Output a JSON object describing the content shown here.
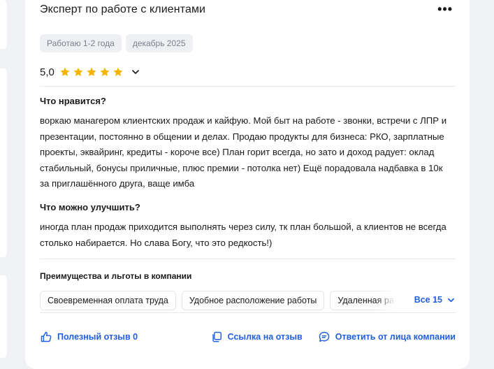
{
  "review": {
    "job_title": "Эксперт по работе с клиентами",
    "tags": [
      "Работаю 1-2 года",
      "декабрь 2025"
    ],
    "rating": "5,0",
    "stars_filled": 5,
    "likes_title": "Что нравится?",
    "likes_text": "воркаю манагером клиентских продаж и кайфую. Мой быт на работе - звонки, встречи с ЛПР и презентации, постоянно в общении и делах. Продаю продукты для бизнеса: РКО, зарплатные проекты, эквайринг, кредиты - короче все) План горит всегда, но зато и доход радует: оклад стабильный, бонусы приличные, плюс премии - потолка нет) Ещё порадовала надбавка в 10к за приглашённого друга, ваще имба",
    "improve_title": "Что можно улучшить?",
    "improve_text": "иногда план продаж приходится выполнять через силу, тк план большой, а клиентов не всегда столько набирается. Но слава Богу, что это редкость!)"
  },
  "benefits": {
    "title": "Преимущества и льготы в компании",
    "chips": [
      "Своевременная оплата труда",
      "Удобное расположение работы",
      "Удаленная работа"
    ],
    "all_label": "Все 15"
  },
  "footer": {
    "useful_label": "Полезный отзыв 0",
    "link_label": "Ссылка на отзыв",
    "reply_label": "Ответить от лица компании"
  },
  "colors": {
    "accent": "#1f5fe0",
    "star": "#f5b400",
    "tag_bg": "#eef0f4"
  },
  "icons": [
    "more-icon",
    "star-icon",
    "chevron-down-icon",
    "thumbs-up-icon",
    "copy-link-icon",
    "chat-icon"
  ]
}
